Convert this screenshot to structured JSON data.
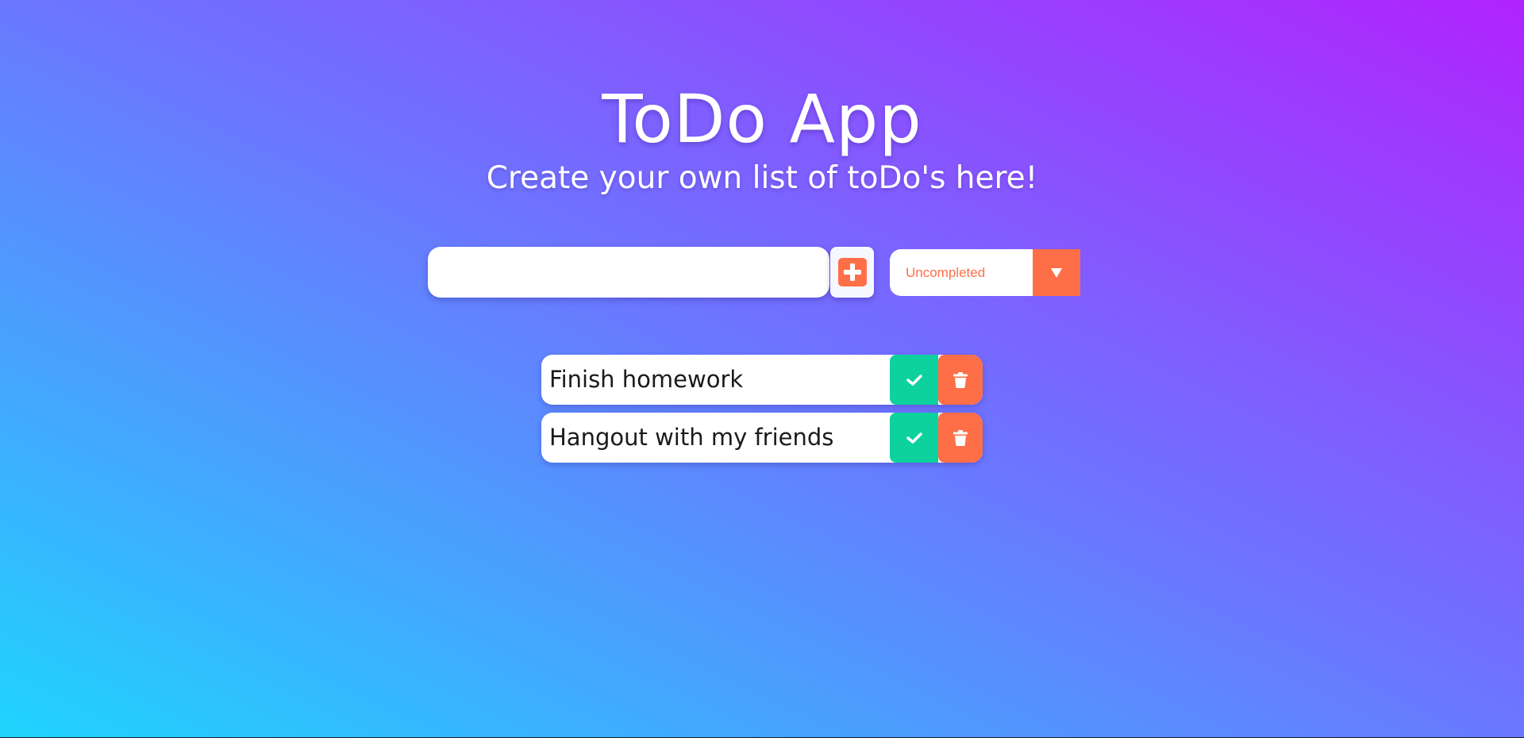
{
  "header": {
    "title": "ToDo App",
    "subtitle": "Create your own list of toDo's here!"
  },
  "form": {
    "input_value": "",
    "input_placeholder": "",
    "add_icon": "plus-square-icon",
    "filter": {
      "selected": "Uncompleted",
      "arrow_icon": "caret-down-icon"
    }
  },
  "todos": [
    {
      "text": "Finish homework",
      "complete_icon": "check-icon",
      "delete_icon": "trash-icon"
    },
    {
      "text": "Hangout with my friends",
      "complete_icon": "check-icon",
      "delete_icon": "trash-icon"
    }
  ],
  "colors": {
    "gradient_start": "#1fd4fd",
    "gradient_mid": "#6a78ff",
    "gradient_end": "#b023fe",
    "accent": "#ff6f47",
    "complete": "#0dd29e"
  }
}
